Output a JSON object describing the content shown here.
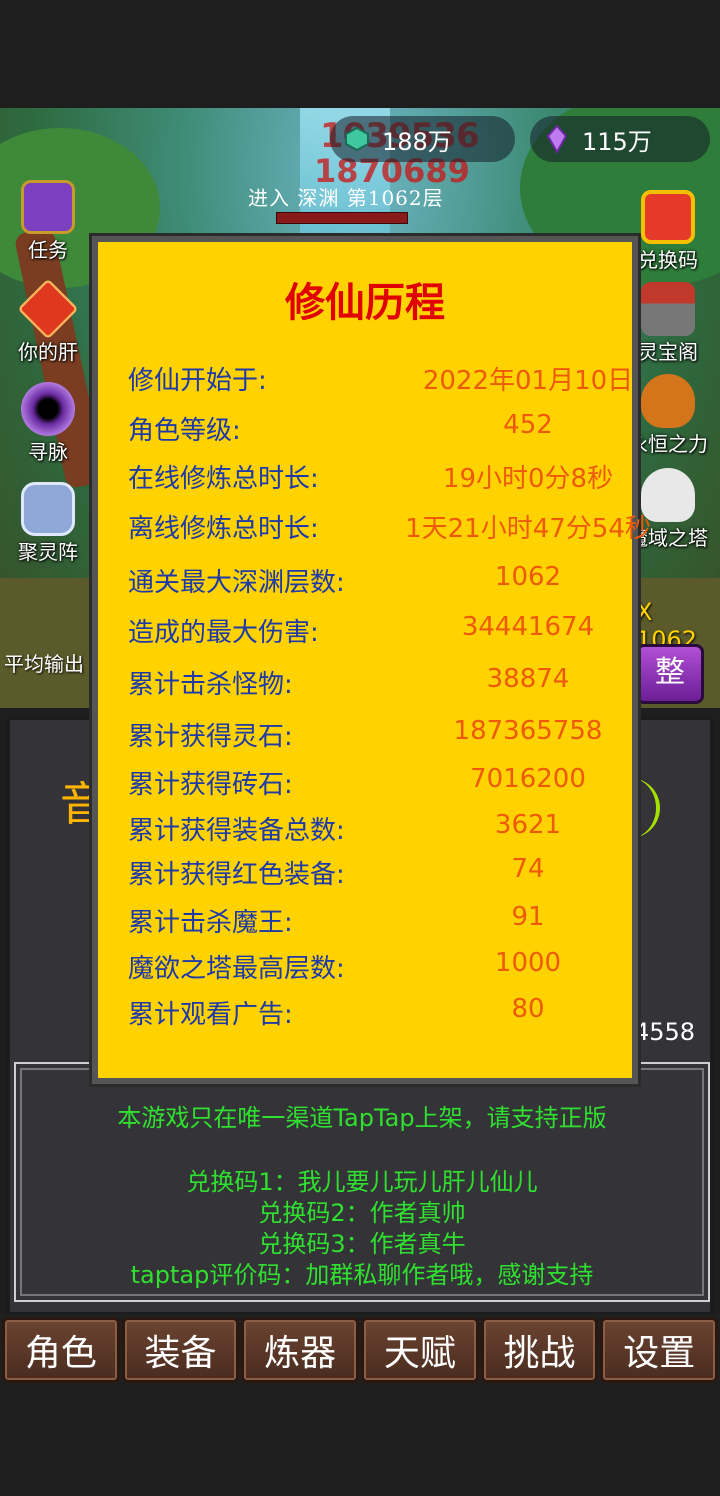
{
  "currency": {
    "gem": "188万",
    "crystal": "115万",
    "damage_float_1": "1039536",
    "damage_float_2": "1870689"
  },
  "stage_label": "进入 深渊 第1062层",
  "left_menu": [
    {
      "label": "任务",
      "icon": "book-icon"
    },
    {
      "label": "你的肝",
      "icon": "liver-gem-icon"
    },
    {
      "label": "寻脉",
      "icon": "eye-orb-icon"
    },
    {
      "label": "聚灵阵",
      "icon": "rune-stone-icon"
    }
  ],
  "right_menu": [
    {
      "label": "兑换码",
      "icon": "gift-icon"
    },
    {
      "label": "灵宝阁",
      "icon": "shop-icon"
    },
    {
      "label": "永恒之力",
      "icon": "demon-skull-icon"
    },
    {
      "label": "魔域之塔",
      "icon": "skull-icon"
    }
  ],
  "side_fragments": {
    "avg_output": "平均输出",
    "right_level": "X 1062",
    "adjust_button": "整",
    "right_number": "4558",
    "gold_char": "音"
  },
  "modal": {
    "title": "修仙历程",
    "rows": [
      {
        "label": "修仙开始于:",
        "value": "2022年01月10日"
      },
      {
        "label": "角色等级:",
        "value": "452"
      },
      {
        "label": "在线修炼总时长:",
        "value": "19小时0分8秒"
      },
      {
        "label": "离线修炼总时长:",
        "value": "1天21小时47分54秒"
      },
      {
        "label": "通关最大深渊层数:",
        "value": "1062"
      },
      {
        "label": "造成的最大伤害:",
        "value": "34441674"
      },
      {
        "label": "累计击杀怪物:",
        "value": "38874"
      },
      {
        "label": "累计获得灵石:",
        "value": "187365758"
      },
      {
        "label": "累计获得砖石:",
        "value": "7016200"
      },
      {
        "label": "累计获得装备总数:",
        "value": "3621"
      },
      {
        "label": "累计获得红色装备:",
        "value": "74"
      },
      {
        "label": "累计击杀魔王:",
        "value": "91"
      },
      {
        "label": "魔欲之塔最高层数:",
        "value": "1000"
      },
      {
        "label": "累计观看广告:",
        "value": "80"
      }
    ]
  },
  "notice": {
    "line1": "本游戏只在唯一渠道TapTap上架，请支持正版",
    "codes": [
      "兑换码1：我儿要儿玩儿肝儿仙儿",
      "兑换码2：作者真帅",
      "兑换码3：作者真牛",
      "taptap评价码：加群私聊作者哦，感谢支持"
    ]
  },
  "bottom_nav": [
    "角色",
    "装备",
    "炼器",
    "天赋",
    "挑战",
    "设置"
  ],
  "colors": {
    "modal_bg": "#ffd200",
    "title_red": "#e00000",
    "label_blue": "#1e3aa8",
    "value_orange": "#ee5a0a",
    "notice_green": "#2fe02f"
  }
}
